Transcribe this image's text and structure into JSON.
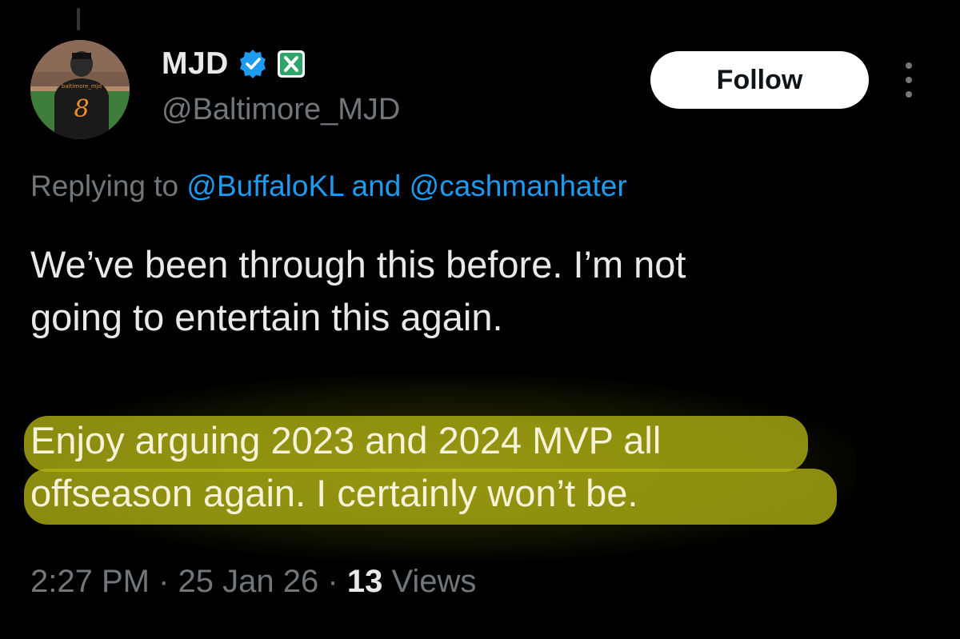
{
  "author": {
    "display_name": "MJD",
    "handle": "@Baltimore_MJD",
    "verified_icon": "verified-badge-icon",
    "affiliate_icon": "x-affiliate-badge-icon",
    "avatar_jersey_number": "8",
    "avatar_jersey_text": "baltimore_mjd"
  },
  "actions": {
    "follow_label": "Follow",
    "more_icon": "more-vertical-icon"
  },
  "reply": {
    "prefix": "Replying to",
    "mention_1": "@BuffaloKL",
    "conjunction": "and",
    "mention_2": "@cashmanhater"
  },
  "tweet": {
    "line_1": "We’ve been through this before. I’m not",
    "line_2": "going to entertain this again.",
    "line_3": "Enjoy arguing 2023 and 2024 MVP all",
    "line_4": "offseason again. I certainly won’t be."
  },
  "meta": {
    "time": "2:27 PM",
    "separator_1": "·",
    "date": "25 Jan 26",
    "separator_2": "·",
    "views_count": "13",
    "views_label": "Views"
  },
  "colors": {
    "background": "#000000",
    "text": "#e7e9ea",
    "secondary": "#71767b",
    "link": "#1d9bf0",
    "verified": "#1d9bf0",
    "affiliate": "#2ea36a",
    "highlight": "#b2b214"
  }
}
